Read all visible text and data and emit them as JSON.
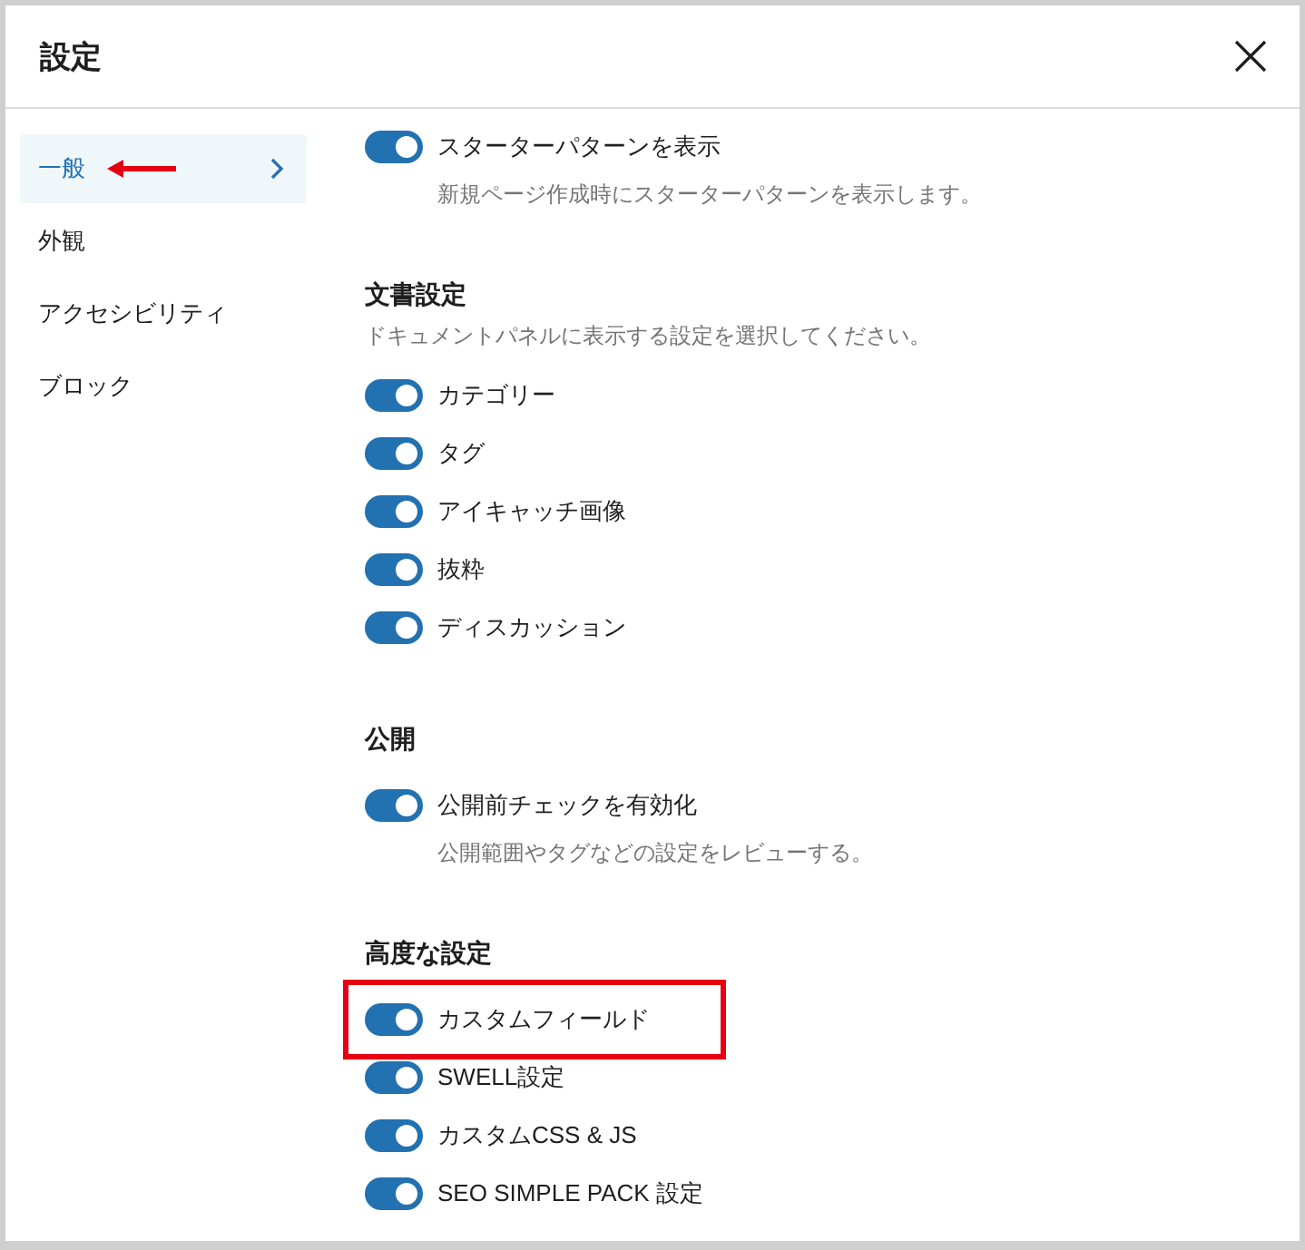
{
  "dialog": {
    "title": "設定"
  },
  "sidebar": {
    "items": [
      {
        "label": "一般",
        "selected": true,
        "annotated": true
      },
      {
        "label": "外観",
        "selected": false,
        "annotated": false
      },
      {
        "label": "アクセシビリティ",
        "selected": false,
        "annotated": false
      },
      {
        "label": "ブロック",
        "selected": false,
        "annotated": false
      }
    ]
  },
  "sections": [
    {
      "rows": [
        {
          "label": "スターターパターンを表示",
          "on": true,
          "annotated": false,
          "description": "新規ページ作成時にスターターパターンを表示します。"
        }
      ]
    },
    {
      "heading": "文書設定",
      "description": "ドキュメントパネルに表示する設定を選択してください。",
      "rows": [
        {
          "label": "カテゴリー",
          "on": true,
          "annotated": false
        },
        {
          "label": "タグ",
          "on": true,
          "annotated": false
        },
        {
          "label": "アイキャッチ画像",
          "on": true,
          "annotated": false
        },
        {
          "label": "抜粋",
          "on": true,
          "annotated": false
        },
        {
          "label": "ディスカッション",
          "on": true,
          "annotated": false
        }
      ]
    },
    {
      "heading": "公開",
      "rows": [
        {
          "label": "公開前チェックを有効化",
          "on": true,
          "annotated": false,
          "description": "公開範囲やタグなどの設定をレビューする。"
        }
      ]
    },
    {
      "heading": "高度な設定",
      "rows": [
        {
          "label": "カスタムフィールド",
          "on": true,
          "annotated": true
        },
        {
          "label": "SWELL設定",
          "on": true,
          "annotated": false
        },
        {
          "label": "カスタムCSS & JS",
          "on": true,
          "annotated": false
        },
        {
          "label": "SEO SIMPLE PACK 設定",
          "on": true,
          "annotated": false
        }
      ]
    }
  ]
}
